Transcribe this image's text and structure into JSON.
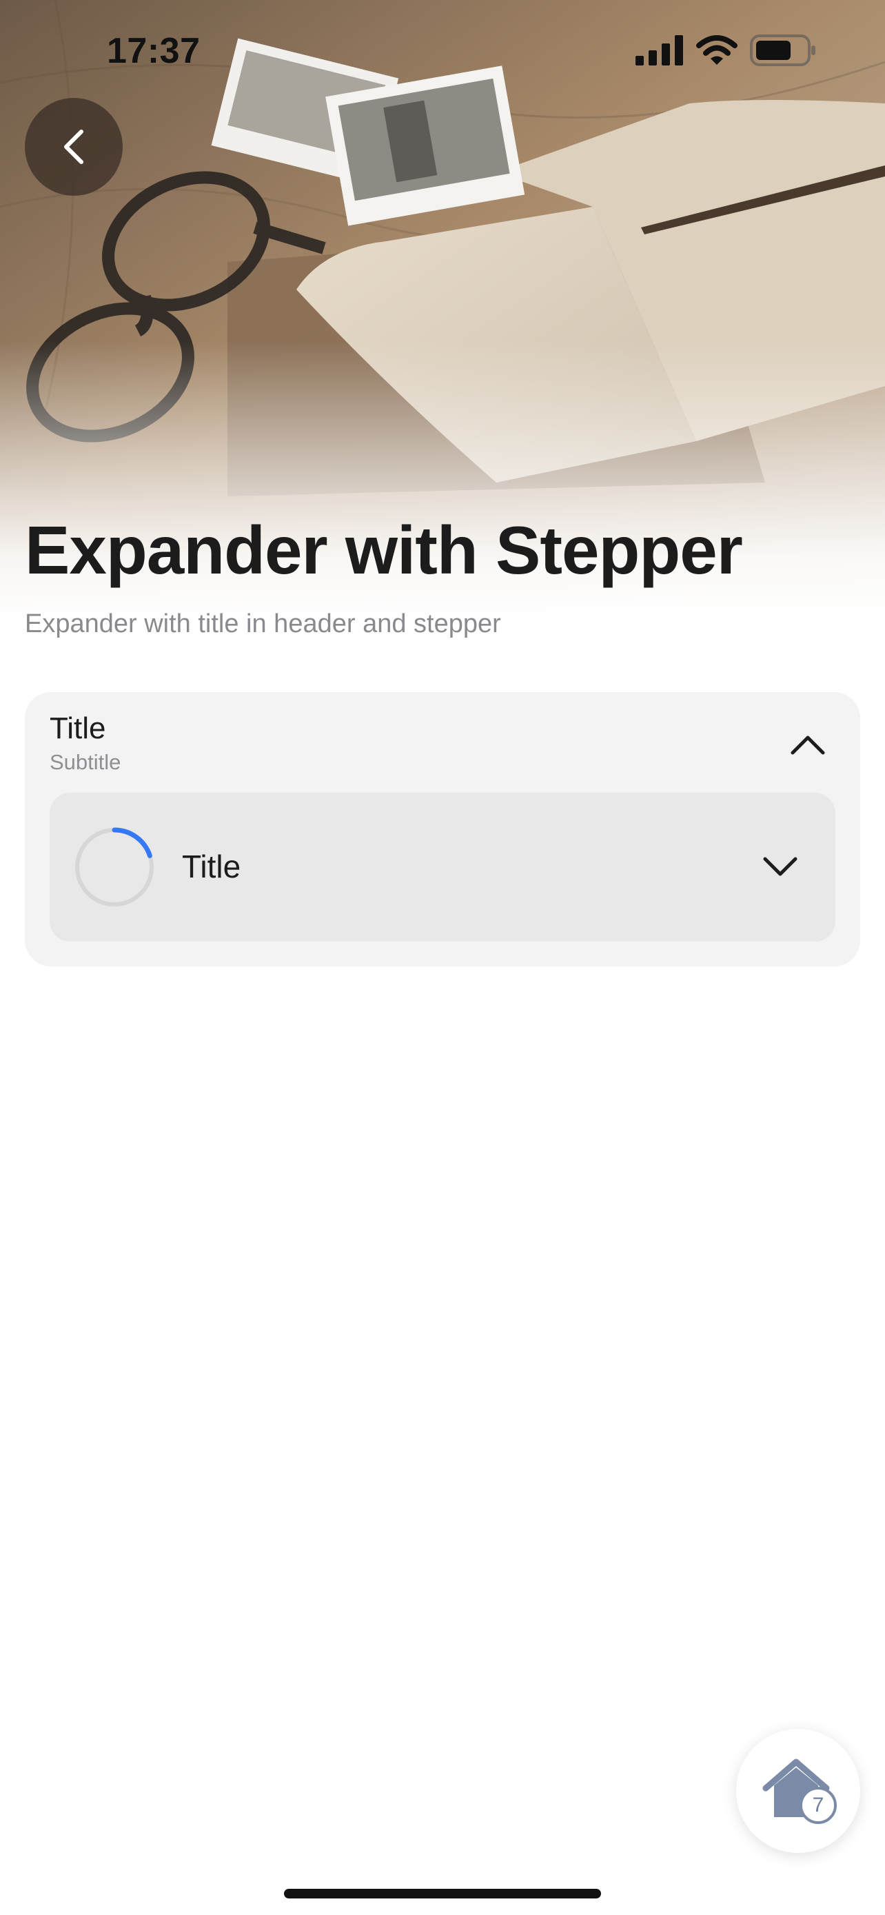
{
  "status_bar": {
    "time": "17:37"
  },
  "hero": {
    "image": "desk-with-glasses-photos-notebook"
  },
  "header": {
    "back_icon": "chevron-left-icon",
    "title": "Expander with Stepper",
    "subtitle": "Expander with title in header and stepper"
  },
  "expander": {
    "title": "Title",
    "subtitle": "Subtitle",
    "expanded": true,
    "stepper": {
      "title": "Title",
      "progress": 0.2,
      "progress_color": "#3478f6",
      "track_color": "#d6d6d6"
    }
  },
  "home_button": {
    "icon": "home-icon",
    "badge": "7"
  },
  "colors": {
    "background": "#ffffff",
    "card": "#f3f3f3",
    "inner_card": "#e8e8e8",
    "accent": "#3478f6"
  }
}
